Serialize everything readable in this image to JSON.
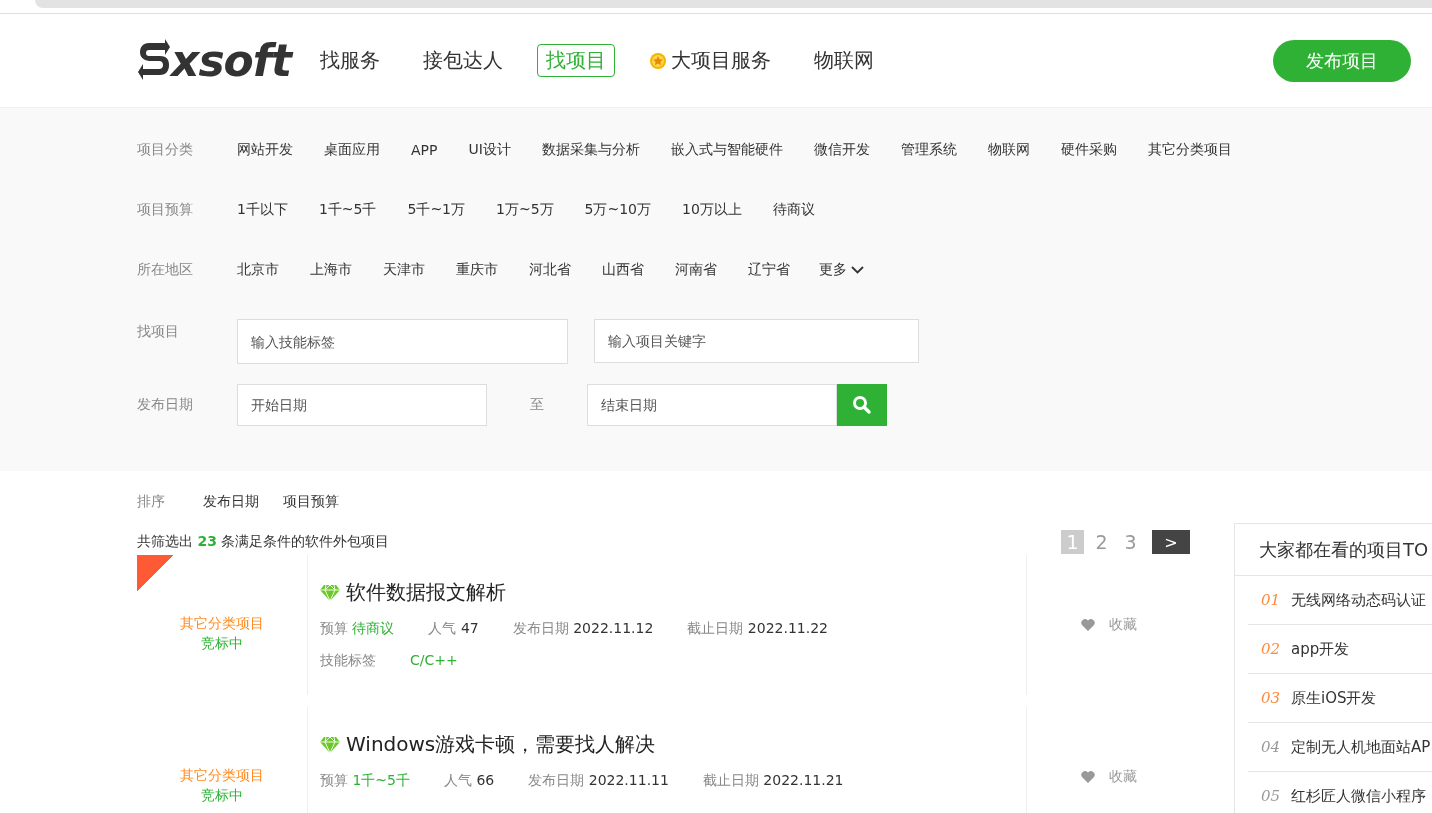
{
  "header": {
    "logo": "xsoft",
    "nav": [
      {
        "label": "找服务",
        "selected": false,
        "kind": "plain"
      },
      {
        "label": "接包达人",
        "selected": false,
        "kind": "plain"
      },
      {
        "label": "找项目",
        "selected": true,
        "kind": "plain"
      },
      {
        "label": "大项目服务",
        "selected": false,
        "kind": "star"
      },
      {
        "label": "物联网",
        "selected": false,
        "kind": "plain"
      }
    ],
    "publish_button": "发布项目"
  },
  "filters": [
    {
      "label": "项目分类",
      "options": [
        "网站开发",
        "桌面应用",
        "APP",
        "UI设计",
        "数据采集与分析",
        "嵌入式与智能硬件",
        "微信开发",
        "管理系统",
        "物联网",
        "硬件采购",
        "其它分类项目"
      ]
    },
    {
      "label": "项目预算",
      "options": [
        "1千以下",
        "1千~5千",
        "5千~1万",
        "1万~5万",
        "5万~10万",
        "10万以上",
        "待商议"
      ]
    },
    {
      "label": "所在地区",
      "options": [
        "北京市",
        "上海市",
        "天津市",
        "重庆市",
        "河北省",
        "山西省",
        "河南省",
        "辽宁省"
      ],
      "more": "更多"
    }
  ],
  "search": {
    "label": "找项目",
    "fields": [
      {
        "placeholder": "输入技能标签"
      },
      {
        "placeholder": "输入项目关键字"
      }
    ]
  },
  "date_filter": {
    "label": "发布日期",
    "start_placeholder": "开始日期",
    "separator": "至",
    "end_placeholder": "结束日期"
  },
  "sort": {
    "label": "排序",
    "options": [
      "发布日期",
      "项目预算"
    ]
  },
  "summary": "共筛选出 **23** 条满足条件的软件外包项目",
  "pagination": {
    "pages": [
      {
        "label": "1",
        "selected": true
      },
      {
        "label": "2",
        "selected": false
      },
      {
        "label": "3",
        "selected": false
      }
    ],
    "next": ">"
  },
  "projects": [
    {
      "is_new": true,
      "category": "其它分类项目",
      "status": "竞标中",
      "title": "软件数据报文解析",
      "budget_label": "预算",
      "budget": "待商议",
      "popularity_label": "人气",
      "popularity": "47",
      "posted_label": "发布日期",
      "posted": "2022.11.12",
      "deadline_label": "截止日期",
      "deadline": "2022.11.22",
      "skills_label": "技能标签",
      "skills": [
        "C/C++"
      ],
      "favorite": "收藏"
    },
    {
      "is_new": false,
      "category": "其它分类项目",
      "status": "竞标中",
      "title": "Windows游戏卡顿，需要找人解决",
      "budget_label": "预算",
      "budget": "1千~5千",
      "popularity_label": "人气",
      "popularity": "66",
      "posted_label": "发布日期",
      "posted": "2022.11.11",
      "deadline_label": "截止日期",
      "deadline": "2022.11.21",
      "favorite": "收藏"
    }
  ],
  "top_list": {
    "title": "大家都在看的项目TO",
    "items": [
      {
        "rank": "01",
        "title": "无线网络动态码认证",
        "color": "#ff8a3d"
      },
      {
        "rank": "02",
        "title": "app开发",
        "color": "#ff8a3d"
      },
      {
        "rank": "03",
        "title": "原生iOS开发",
        "color": "#ff8a3d"
      },
      {
        "rank": "04",
        "title": "定制无人机地面站AP",
        "color": "#999999"
      },
      {
        "rank": "05",
        "title": "红杉匠人微信小程序",
        "color": "#999999"
      }
    ]
  }
}
